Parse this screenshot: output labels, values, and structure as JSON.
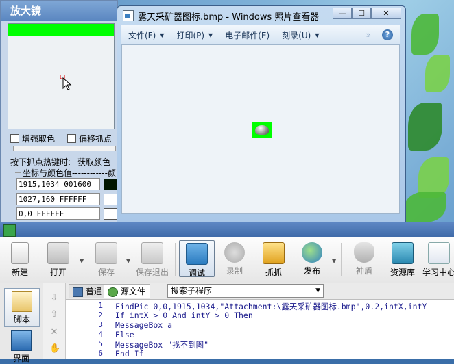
{
  "magnifier": {
    "title": "放大镜",
    "enhance_label": "增强取色",
    "offset_label": "偏移抓点",
    "hotkey_label": "按下抓点热键时:",
    "hotkey_value": "获取颜色",
    "group_label": "坐标与颜色值------------颜色",
    "rows": [
      {
        "text": "1915,1034  001600",
        "color": "#001600"
      },
      {
        "text": "1027,160  FFFFFF",
        "color": "#FFFFFF"
      },
      {
        "text": "0,0  FFFFFF",
        "color": "#FFFFFF"
      }
    ]
  },
  "photo_viewer": {
    "title": "露天采矿器图标.bmp - Windows 照片查看器",
    "menu": [
      {
        "label": "文件(F)",
        "dropdown": true
      },
      {
        "label": "打印(P)",
        "dropdown": true
      },
      {
        "label": "电子邮件(E)",
        "dropdown": false
      },
      {
        "label": "刻录(U)",
        "dropdown": true
      }
    ],
    "more": "»",
    "help": "?",
    "minimize": "—",
    "maximize": "☐",
    "close": "✕"
  },
  "ide": {
    "toolbar": [
      {
        "label": "新建",
        "icon": "new-file-icon",
        "dim": false
      },
      {
        "label": "打开",
        "icon": "open-folder-icon",
        "dim": false
      },
      {
        "label": "保存",
        "icon": "save-icon",
        "dim": true
      },
      {
        "label": "保存退出",
        "icon": "save-exit-icon",
        "dim": true
      },
      {
        "label": "调试",
        "icon": "debug-icon",
        "dim": false
      },
      {
        "label": "录制",
        "icon": "record-icon",
        "dim": true
      },
      {
        "label": "抓抓",
        "icon": "grab-icon",
        "dim": false
      },
      {
        "label": "发布",
        "icon": "publish-icon",
        "dim": false
      },
      {
        "label": "神盾",
        "icon": "shield-icon",
        "dim": true
      },
      {
        "label": "资源库",
        "icon": "library-icon",
        "dim": false
      },
      {
        "label": "学习中心",
        "icon": "learning-center-icon",
        "dim": false
      }
    ],
    "left_panel": [
      {
        "label": "脚本"
      },
      {
        "label": "界面"
      }
    ],
    "tabs": [
      {
        "label": "普通"
      },
      {
        "label": "源文件"
      }
    ],
    "sub_search": "搜索子程序",
    "code_lines": [
      {
        "num": "1",
        "text": "FindPic 0,0,1915,1034,\"Attachment:\\露天采矿器图标.bmp\",0.2,intX,intY"
      },
      {
        "num": "2",
        "text": "If intX > 0 And intY > 0 Then"
      },
      {
        "num": "3",
        "text": "MessageBox a"
      },
      {
        "num": "4",
        "text": "Else"
      },
      {
        "num": "5",
        "text": "MessageBox \"找不到图\""
      },
      {
        "num": "6",
        "text": "End If"
      }
    ]
  },
  "colors": {
    "green_bar": "#00FF00",
    "code_text": "#1A1A8C",
    "titlebar": "#3F6AA8"
  }
}
